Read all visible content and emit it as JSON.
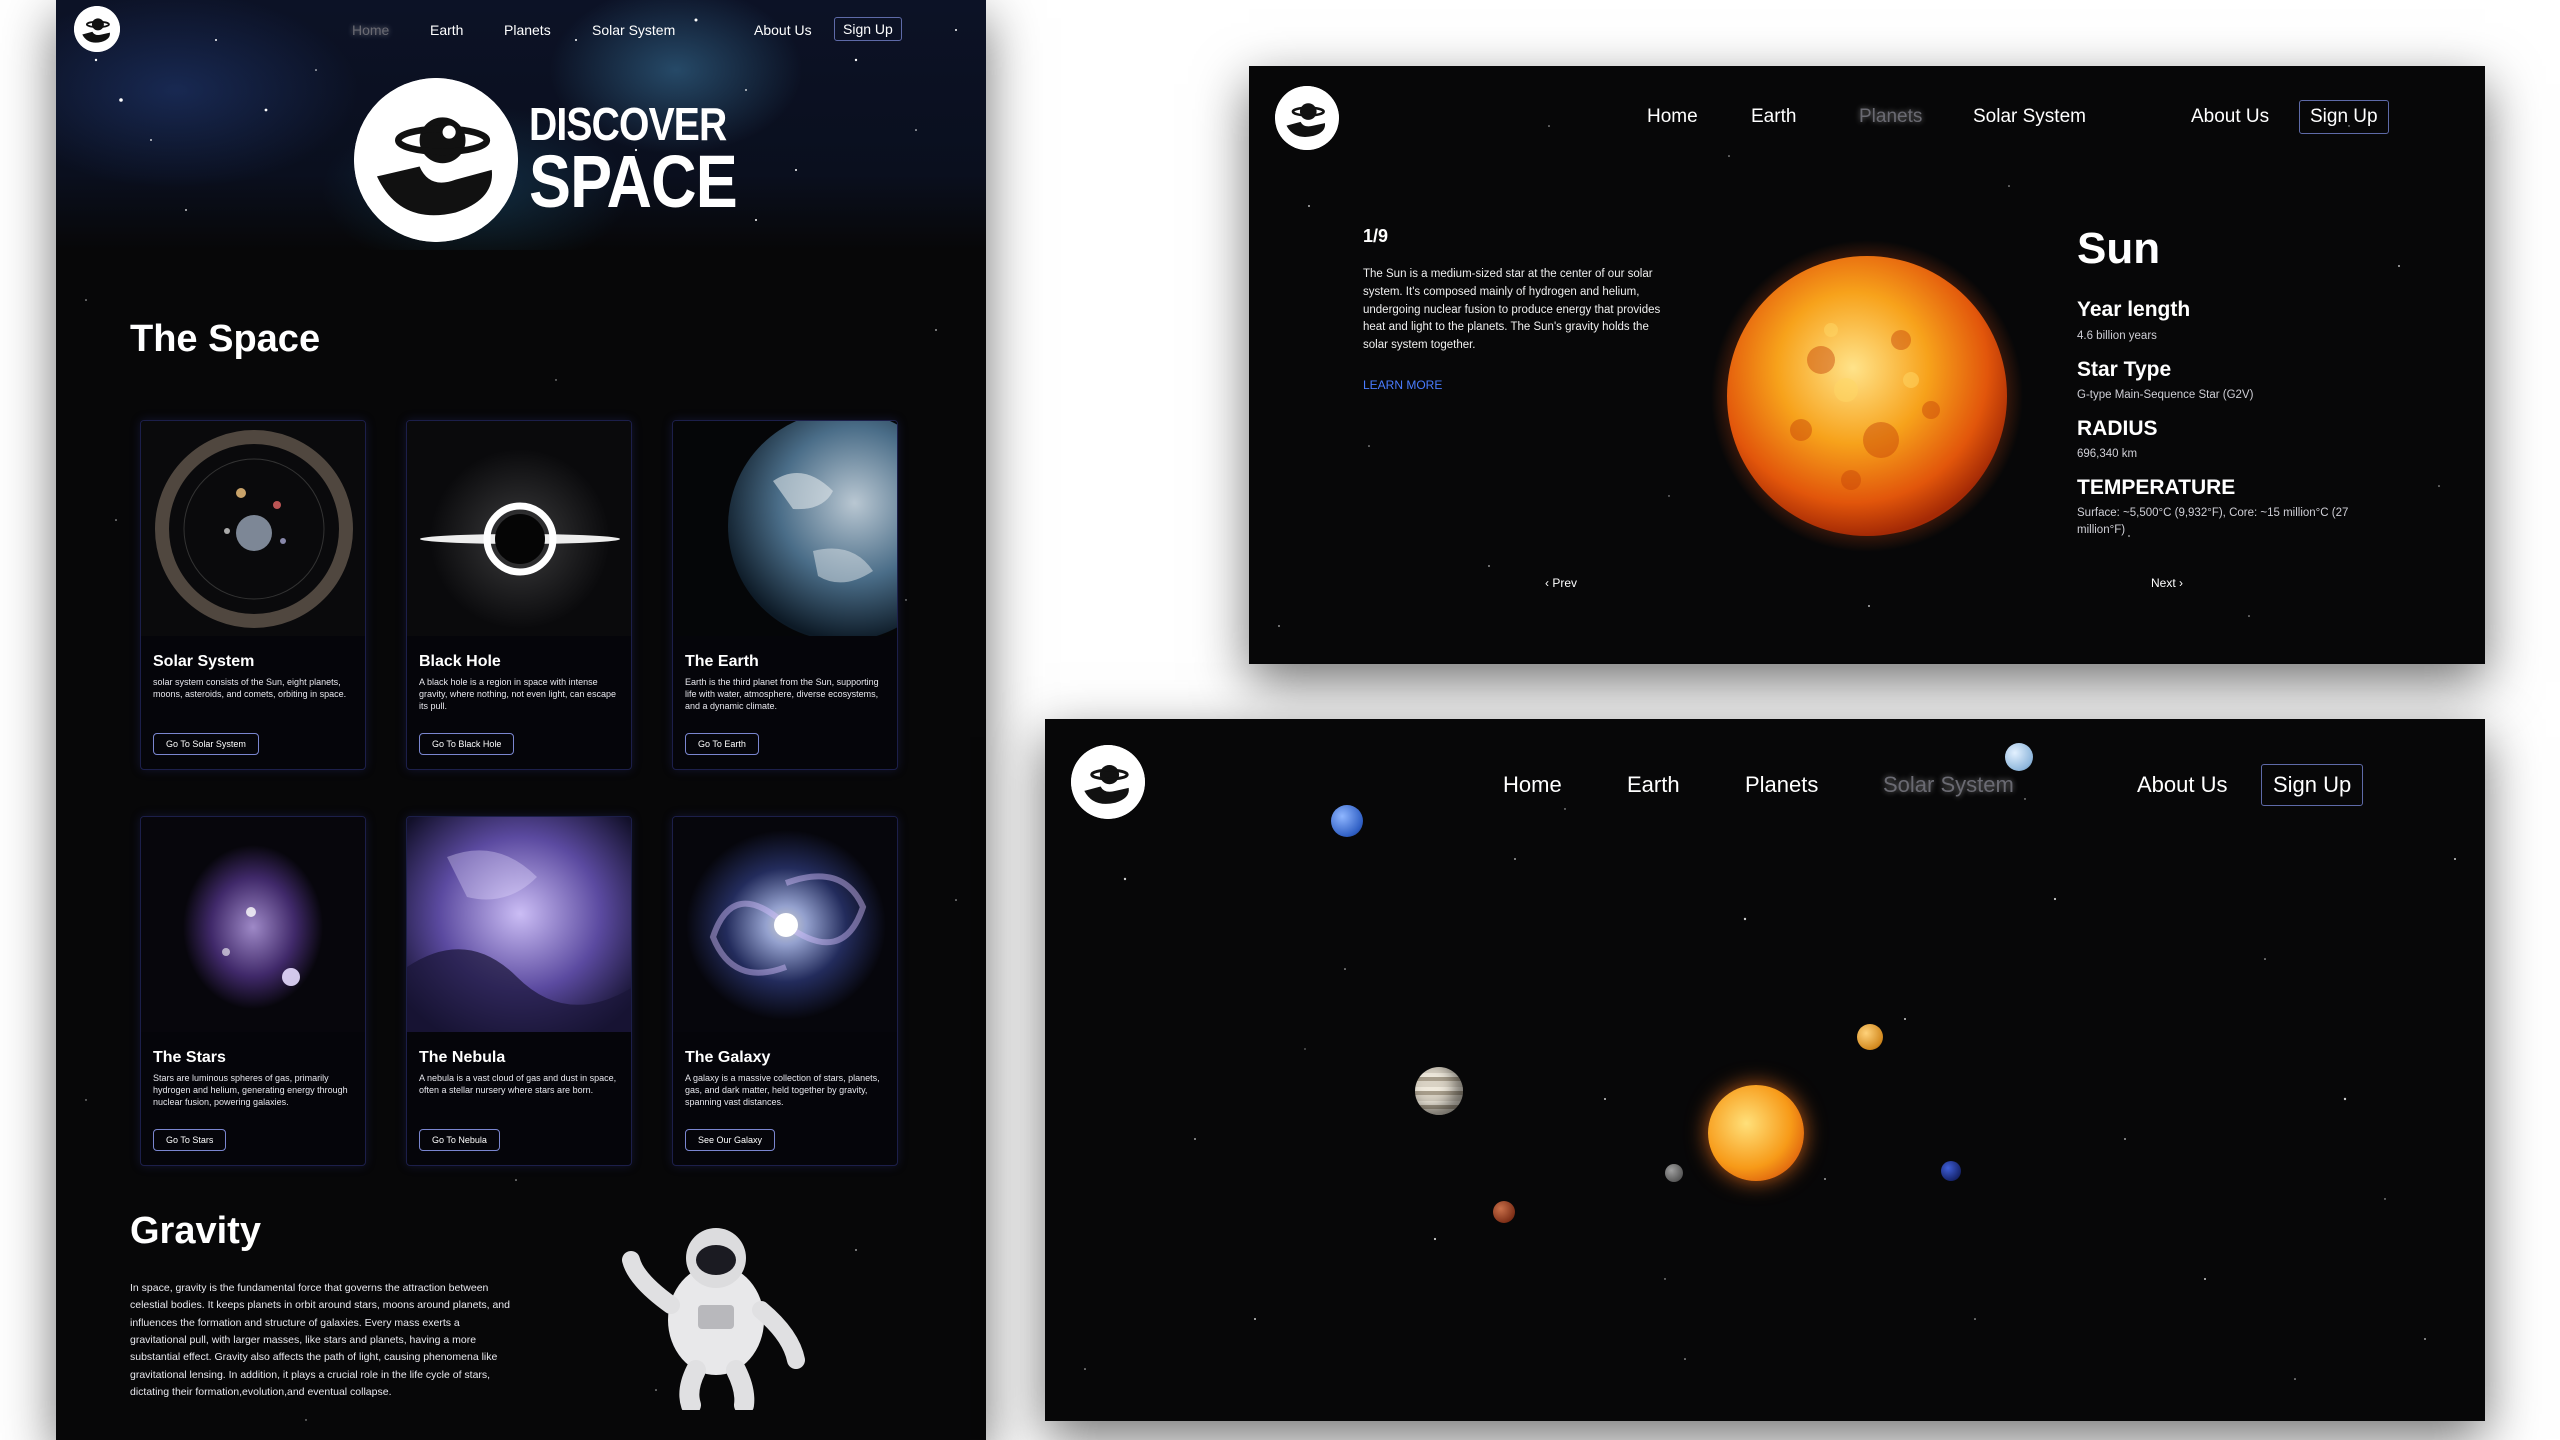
{
  "nav": {
    "home": "Home",
    "earth": "Earth",
    "planets": "Planets",
    "solar_system": "Solar System",
    "about": "About Us",
    "signup": "Sign Up"
  },
  "home_page": {
    "hero_title_line1": "DISCOVER",
    "hero_title_line2": "SPACE",
    "section_title": "The Space",
    "cards": [
      {
        "title": "Solar System",
        "desc": "solar system consists of the Sun, eight planets, moons, asteroids, and comets, orbiting in space.",
        "button": "Go To Solar System"
      },
      {
        "title": "Black Hole",
        "desc": "A black hole is a region in space with intense gravity, where nothing, not even light, can escape its pull.",
        "button": "Go To Black Hole"
      },
      {
        "title": "The Earth",
        "desc": "Earth is the third planet from the Sun, supporting life with water, atmosphere, diverse ecosystems, and a dynamic climate.",
        "button": "Go To Earth"
      },
      {
        "title": "The Stars",
        "desc": "Stars are luminous spheres of gas, primarily hydrogen and helium, generating energy through nuclear fusion, powering galaxies.",
        "button": "Go To Stars"
      },
      {
        "title": "The Nebula",
        "desc": "A nebula is a vast cloud of gas and dust in space, often a stellar nursery where stars are born.",
        "button": "Go To Nebula"
      },
      {
        "title": "The Galaxy",
        "desc": "A galaxy is a massive collection of stars, planets, gas, and dark matter, held together by gravity, spanning vast distances.",
        "button": "See Our Galaxy"
      }
    ],
    "gravity_title": "Gravity",
    "gravity_text": "In space, gravity is the fundamental force that governs the attraction between celestial bodies. It keeps planets in orbit around stars, moons around planets, and influences the formation and structure of galaxies. Every mass exerts a gravitational pull, with larger masses, like stars and planets, having a more substantial effect. Gravity also affects the path of light, causing phenomena like gravitational lensing. In addition, it plays a crucial role in the life cycle of stars, dictating their formation,evolution,and eventual collapse."
  },
  "planet_page": {
    "counter": "1/9",
    "description": "The Sun is a medium-sized star at the center of our solar system. It's composed mainly of hydrogen and helium, undergoing nuclear fusion to produce energy that provides heat and light to the planets. The Sun's gravity holds the solar system together.",
    "learn_more": "LEARN MORE",
    "name": "Sun",
    "stats": [
      {
        "label": "Year length",
        "value": "4.6 billion years"
      },
      {
        "label": "Star Type",
        "value": "G-type Main-Sequence Star (G2V)"
      },
      {
        "label": "RADIUS",
        "value": "696,340 km"
      },
      {
        "label": "TEMPERATURE",
        "value": "Surface: ~5,500°C (9,932°F), Core: ~15 million°C (27 million°F)"
      }
    ],
    "prev": "‹  Prev",
    "next": "Next  ›"
  },
  "colors": {
    "background": "#070708",
    "accent_link": "#4a7cff",
    "card_border": "#1c1f4a",
    "active_nav": "#6a6a72"
  },
  "icons": {
    "logo": "astronaut-hand-planet-logo",
    "prev": "chevron-left-icon",
    "next": "chevron-right-icon"
  }
}
